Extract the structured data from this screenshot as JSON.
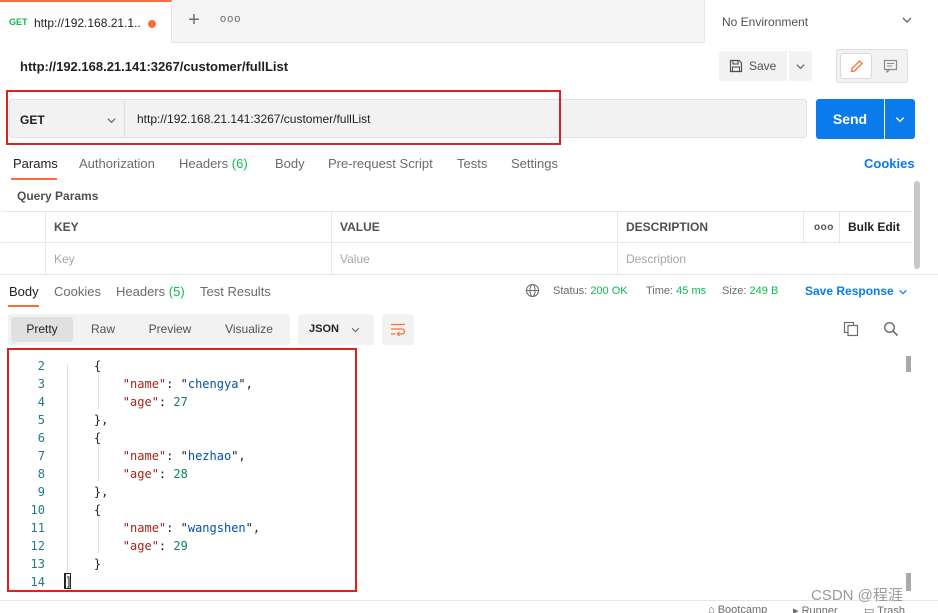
{
  "tab": {
    "method": "GET",
    "title": "http://192.168.21.1..."
  },
  "environment": {
    "label": "No Environment"
  },
  "request": {
    "title": "http://192.168.21.141:3267/customer/fullList",
    "method": "GET",
    "url": "http://192.168.21.141:3267/customer/fullList",
    "save_label": "Save",
    "send_label": "Send"
  },
  "request_tabs": [
    {
      "label": "Params"
    },
    {
      "label": "Authorization"
    },
    {
      "label": "Headers",
      "count": "(6)"
    },
    {
      "label": "Body"
    },
    {
      "label": "Pre-request Script"
    },
    {
      "label": "Tests"
    },
    {
      "label": "Settings"
    }
  ],
  "cookies_link": "Cookies",
  "query_params": {
    "title": "Query Params",
    "headers": [
      "KEY",
      "VALUE",
      "DESCRIPTION"
    ],
    "bulk_edit": "Bulk Edit",
    "placeholders": [
      "Key",
      "Value",
      "Description"
    ]
  },
  "response_tabs": [
    {
      "label": "Body"
    },
    {
      "label": "Cookies"
    },
    {
      "label": "Headers",
      "count": "(5)"
    },
    {
      "label": "Test Results"
    }
  ],
  "response_meta": {
    "status_label": "Status:",
    "status_value": "200 OK",
    "time_label": "Time:",
    "time_value": "45 ms",
    "size_label": "Size:",
    "size_value": "249 B",
    "save_response": "Save Response"
  },
  "view_modes": [
    "Pretty",
    "Raw",
    "Preview",
    "Visualize"
  ],
  "format": "JSON",
  "code": {
    "line_numbers": [
      "2",
      "3",
      "4",
      "5",
      "6",
      "7",
      "8",
      "9",
      "10",
      "11",
      "12",
      "13",
      "14"
    ],
    "names": [
      "chengya",
      "hezhao",
      "wangshen"
    ],
    "ages": [
      "27",
      "28",
      "29"
    ],
    "key_name": "\"name\"",
    "key_age": "\"age\"",
    "open_brace": "{",
    "close_brace_comma": "},",
    "close_brace": "}",
    "close_bracket": "]"
  },
  "statusbar": {
    "bootcamp": "Bootcamp",
    "runner": "Runner",
    "trash": "Trash"
  },
  "watermark": "CSDN @程涯",
  "colors": {
    "accent": "#ff6c37",
    "send": "#097bed",
    "status_ok": "#0cbb52",
    "annotation": "#e02020"
  }
}
